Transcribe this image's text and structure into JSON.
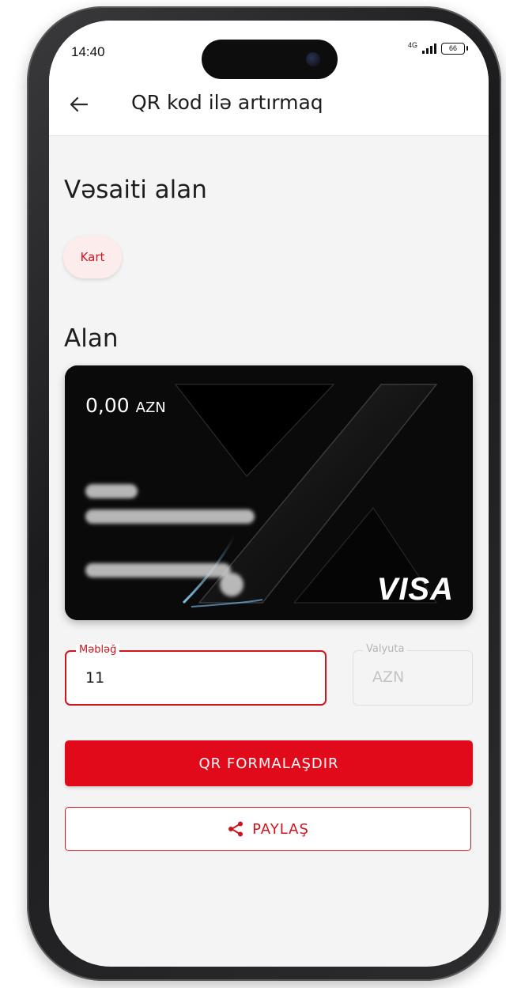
{
  "status_bar": {
    "time": "14:40",
    "network": "4G",
    "battery": "66"
  },
  "header": {
    "title": "QR kod ilə artırmaq",
    "back_icon": "arrow-left-icon"
  },
  "recipient_section": {
    "title": "Vəsaiti alan",
    "chip_label": "Kart"
  },
  "receiver_section": {
    "title": "Alan"
  },
  "card": {
    "balance_amount": "0,00",
    "balance_currency": "AZN",
    "brand": "VISA"
  },
  "form": {
    "amount": {
      "label": "Məbləğ",
      "value": "11"
    },
    "currency": {
      "label": "Valyuta",
      "value": "AZN"
    }
  },
  "actions": {
    "primary_label": "QR FORMALAŞDIR",
    "share_label": "PAYLAŞ",
    "share_icon": "share-icon"
  },
  "colors": {
    "accent": "#e00a1a",
    "accent_text": "#d0141e",
    "chip_bg": "#fdecec",
    "screen_bg": "#f4f4f4"
  }
}
